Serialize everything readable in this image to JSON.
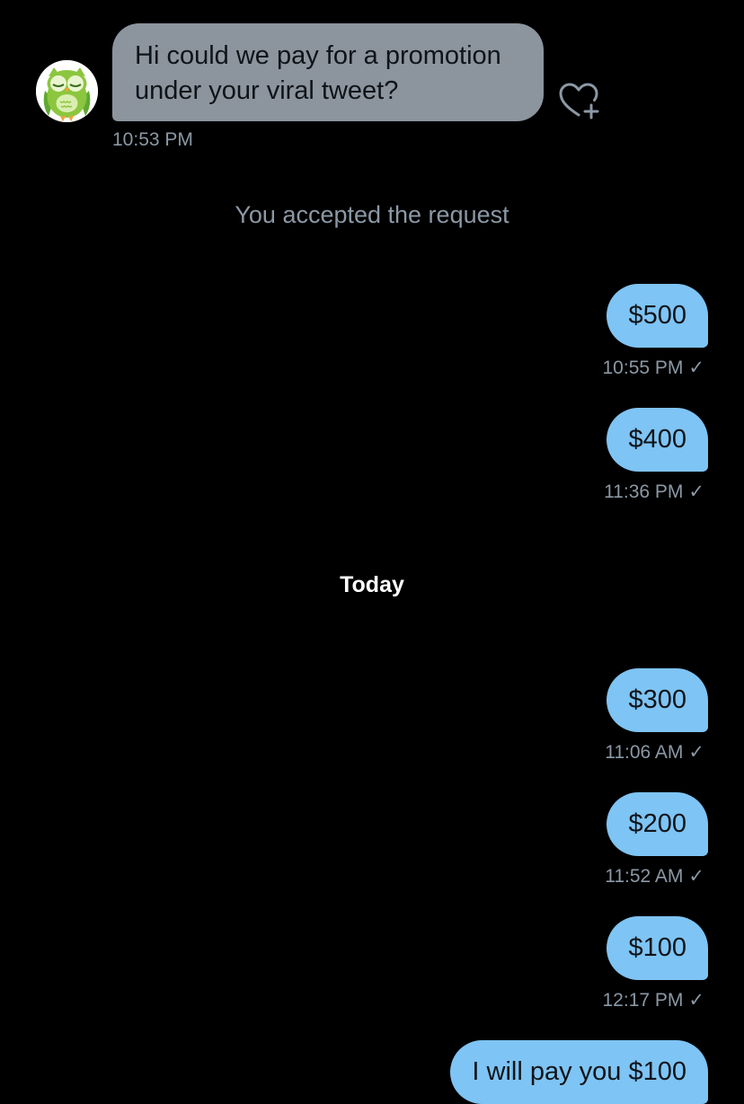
{
  "incoming_message": {
    "text": "Hi could we pay for a promotion under your viral tweet?",
    "time": "10:53 PM"
  },
  "system_message": "You accepted the request",
  "day_divider": "Today",
  "sent_status_icon": "✓",
  "outgoing_messages": [
    {
      "text": "$500",
      "time": "10:55 PM"
    },
    {
      "text": "$400",
      "time": "11:36 PM"
    },
    {
      "text": "$300",
      "time": "11:06 AM"
    },
    {
      "text": "$200",
      "time": "11:52 AM"
    },
    {
      "text": "$100",
      "time": "12:17 PM"
    },
    {
      "text": "I will pay you $100"
    }
  ],
  "icons": {
    "avatar": "owl-avatar",
    "reaction": "heart-plus-icon",
    "sent": "checkmark-icon"
  },
  "colors": {
    "background": "#000000",
    "incoming_bubble": "#8c959e",
    "outgoing_bubble": "#7ec4f4",
    "muted_text": "#8b98a5"
  }
}
